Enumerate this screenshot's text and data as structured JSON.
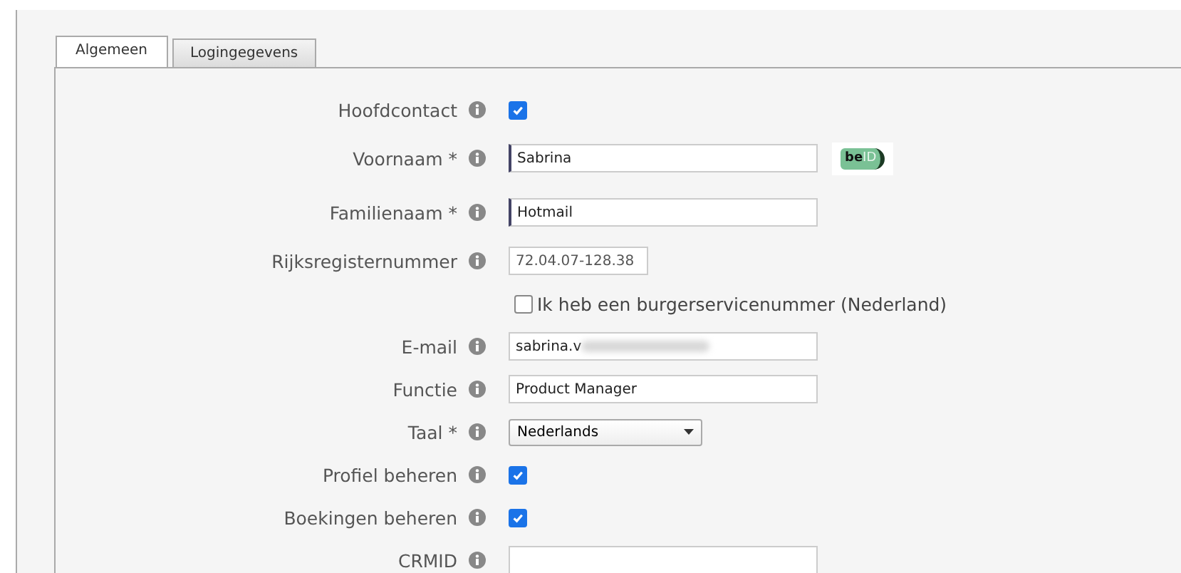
{
  "tabs": [
    {
      "label": "Algemeen",
      "selected": true
    },
    {
      "label": "Logingegevens",
      "selected": false
    }
  ],
  "fields": [
    {
      "kind": "checkbox",
      "label": "Hoofdcontact",
      "checked": true
    },
    {
      "kind": "text",
      "label": "Voornaam *",
      "value": "Sabrina",
      "focused": true,
      "beid": {
        "part_1": "be",
        "part_2": "ID"
      }
    },
    {
      "kind": "text",
      "label": "Familienaam *",
      "value": "Hotmail",
      "focused": true
    },
    {
      "kind": "short_text",
      "label": "Rijksregisternummer",
      "value": "72.04.07-128.38"
    },
    {
      "kind": "option",
      "label": "Ik heb een burgerservicenummer (Nederland)",
      "checked": false
    },
    {
      "kind": "text",
      "label": "E-mail",
      "value": "sabrina.v",
      "redacted": true
    },
    {
      "kind": "text",
      "label": "Functie",
      "value": "Product Manager"
    },
    {
      "kind": "select",
      "label": "Taal *",
      "value": "Nederlands"
    },
    {
      "kind": "checkbox",
      "label": "Profiel beheren",
      "checked": true
    },
    {
      "kind": "checkbox",
      "label": "Boekingen beheren",
      "checked": true
    },
    {
      "kind": "text",
      "label": "CRMID"
    }
  ]
}
